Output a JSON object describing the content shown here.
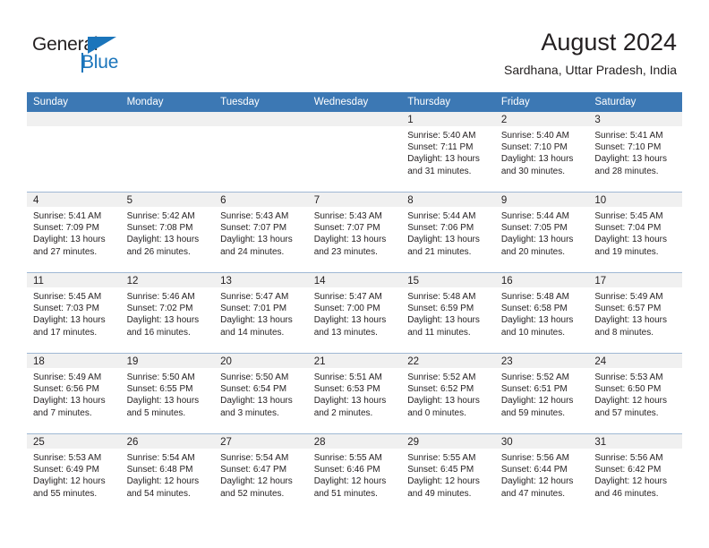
{
  "brand": {
    "name_part1": "General",
    "name_part2": "Blue",
    "triangle_color": "#1b75bb"
  },
  "header": {
    "title": "August 2024",
    "subtitle": "Sardhana, Uttar Pradesh, India"
  },
  "theme": {
    "header_band": "#3c78b4",
    "daynum_strip": "#f0f0f0",
    "grid_line": "#9fb8d4",
    "text": "#231f20"
  },
  "weekday_headers": [
    "Sunday",
    "Monday",
    "Tuesday",
    "Wednesday",
    "Thursday",
    "Friday",
    "Saturday"
  ],
  "weeks": [
    [
      {
        "day": "",
        "sunrise": "",
        "sunset": "",
        "daylight_line1": "",
        "daylight_line2": ""
      },
      {
        "day": "",
        "sunrise": "",
        "sunset": "",
        "daylight_line1": "",
        "daylight_line2": ""
      },
      {
        "day": "",
        "sunrise": "",
        "sunset": "",
        "daylight_line1": "",
        "daylight_line2": ""
      },
      {
        "day": "",
        "sunrise": "",
        "sunset": "",
        "daylight_line1": "",
        "daylight_line2": ""
      },
      {
        "day": "1",
        "sunrise": "Sunrise: 5:40 AM",
        "sunset": "Sunset: 7:11 PM",
        "daylight_line1": "Daylight: 13 hours",
        "daylight_line2": "and 31 minutes."
      },
      {
        "day": "2",
        "sunrise": "Sunrise: 5:40 AM",
        "sunset": "Sunset: 7:10 PM",
        "daylight_line1": "Daylight: 13 hours",
        "daylight_line2": "and 30 minutes."
      },
      {
        "day": "3",
        "sunrise": "Sunrise: 5:41 AM",
        "sunset": "Sunset: 7:10 PM",
        "daylight_line1": "Daylight: 13 hours",
        "daylight_line2": "and 28 minutes."
      }
    ],
    [
      {
        "day": "4",
        "sunrise": "Sunrise: 5:41 AM",
        "sunset": "Sunset: 7:09 PM",
        "daylight_line1": "Daylight: 13 hours",
        "daylight_line2": "and 27 minutes."
      },
      {
        "day": "5",
        "sunrise": "Sunrise: 5:42 AM",
        "sunset": "Sunset: 7:08 PM",
        "daylight_line1": "Daylight: 13 hours",
        "daylight_line2": "and 26 minutes."
      },
      {
        "day": "6",
        "sunrise": "Sunrise: 5:43 AM",
        "sunset": "Sunset: 7:07 PM",
        "daylight_line1": "Daylight: 13 hours",
        "daylight_line2": "and 24 minutes."
      },
      {
        "day": "7",
        "sunrise": "Sunrise: 5:43 AM",
        "sunset": "Sunset: 7:07 PM",
        "daylight_line1": "Daylight: 13 hours",
        "daylight_line2": "and 23 minutes."
      },
      {
        "day": "8",
        "sunrise": "Sunrise: 5:44 AM",
        "sunset": "Sunset: 7:06 PM",
        "daylight_line1": "Daylight: 13 hours",
        "daylight_line2": "and 21 minutes."
      },
      {
        "day": "9",
        "sunrise": "Sunrise: 5:44 AM",
        "sunset": "Sunset: 7:05 PM",
        "daylight_line1": "Daylight: 13 hours",
        "daylight_line2": "and 20 minutes."
      },
      {
        "day": "10",
        "sunrise": "Sunrise: 5:45 AM",
        "sunset": "Sunset: 7:04 PM",
        "daylight_line1": "Daylight: 13 hours",
        "daylight_line2": "and 19 minutes."
      }
    ],
    [
      {
        "day": "11",
        "sunrise": "Sunrise: 5:45 AM",
        "sunset": "Sunset: 7:03 PM",
        "daylight_line1": "Daylight: 13 hours",
        "daylight_line2": "and 17 minutes."
      },
      {
        "day": "12",
        "sunrise": "Sunrise: 5:46 AM",
        "sunset": "Sunset: 7:02 PM",
        "daylight_line1": "Daylight: 13 hours",
        "daylight_line2": "and 16 minutes."
      },
      {
        "day": "13",
        "sunrise": "Sunrise: 5:47 AM",
        "sunset": "Sunset: 7:01 PM",
        "daylight_line1": "Daylight: 13 hours",
        "daylight_line2": "and 14 minutes."
      },
      {
        "day": "14",
        "sunrise": "Sunrise: 5:47 AM",
        "sunset": "Sunset: 7:00 PM",
        "daylight_line1": "Daylight: 13 hours",
        "daylight_line2": "and 13 minutes."
      },
      {
        "day": "15",
        "sunrise": "Sunrise: 5:48 AM",
        "sunset": "Sunset: 6:59 PM",
        "daylight_line1": "Daylight: 13 hours",
        "daylight_line2": "and 11 minutes."
      },
      {
        "day": "16",
        "sunrise": "Sunrise: 5:48 AM",
        "sunset": "Sunset: 6:58 PM",
        "daylight_line1": "Daylight: 13 hours",
        "daylight_line2": "and 10 minutes."
      },
      {
        "day": "17",
        "sunrise": "Sunrise: 5:49 AM",
        "sunset": "Sunset: 6:57 PM",
        "daylight_line1": "Daylight: 13 hours",
        "daylight_line2": "and 8 minutes."
      }
    ],
    [
      {
        "day": "18",
        "sunrise": "Sunrise: 5:49 AM",
        "sunset": "Sunset: 6:56 PM",
        "daylight_line1": "Daylight: 13 hours",
        "daylight_line2": "and 7 minutes."
      },
      {
        "day": "19",
        "sunrise": "Sunrise: 5:50 AM",
        "sunset": "Sunset: 6:55 PM",
        "daylight_line1": "Daylight: 13 hours",
        "daylight_line2": "and 5 minutes."
      },
      {
        "day": "20",
        "sunrise": "Sunrise: 5:50 AM",
        "sunset": "Sunset: 6:54 PM",
        "daylight_line1": "Daylight: 13 hours",
        "daylight_line2": "and 3 minutes."
      },
      {
        "day": "21",
        "sunrise": "Sunrise: 5:51 AM",
        "sunset": "Sunset: 6:53 PM",
        "daylight_line1": "Daylight: 13 hours",
        "daylight_line2": "and 2 minutes."
      },
      {
        "day": "22",
        "sunrise": "Sunrise: 5:52 AM",
        "sunset": "Sunset: 6:52 PM",
        "daylight_line1": "Daylight: 13 hours",
        "daylight_line2": "and 0 minutes."
      },
      {
        "day": "23",
        "sunrise": "Sunrise: 5:52 AM",
        "sunset": "Sunset: 6:51 PM",
        "daylight_line1": "Daylight: 12 hours",
        "daylight_line2": "and 59 minutes."
      },
      {
        "day": "24",
        "sunrise": "Sunrise: 5:53 AM",
        "sunset": "Sunset: 6:50 PM",
        "daylight_line1": "Daylight: 12 hours",
        "daylight_line2": "and 57 minutes."
      }
    ],
    [
      {
        "day": "25",
        "sunrise": "Sunrise: 5:53 AM",
        "sunset": "Sunset: 6:49 PM",
        "daylight_line1": "Daylight: 12 hours",
        "daylight_line2": "and 55 minutes."
      },
      {
        "day": "26",
        "sunrise": "Sunrise: 5:54 AM",
        "sunset": "Sunset: 6:48 PM",
        "daylight_line1": "Daylight: 12 hours",
        "daylight_line2": "and 54 minutes."
      },
      {
        "day": "27",
        "sunrise": "Sunrise: 5:54 AM",
        "sunset": "Sunset: 6:47 PM",
        "daylight_line1": "Daylight: 12 hours",
        "daylight_line2": "and 52 minutes."
      },
      {
        "day": "28",
        "sunrise": "Sunrise: 5:55 AM",
        "sunset": "Sunset: 6:46 PM",
        "daylight_line1": "Daylight: 12 hours",
        "daylight_line2": "and 51 minutes."
      },
      {
        "day": "29",
        "sunrise": "Sunrise: 5:55 AM",
        "sunset": "Sunset: 6:45 PM",
        "daylight_line1": "Daylight: 12 hours",
        "daylight_line2": "and 49 minutes."
      },
      {
        "day": "30",
        "sunrise": "Sunrise: 5:56 AM",
        "sunset": "Sunset: 6:44 PM",
        "daylight_line1": "Daylight: 12 hours",
        "daylight_line2": "and 47 minutes."
      },
      {
        "day": "31",
        "sunrise": "Sunrise: 5:56 AM",
        "sunset": "Sunset: 6:42 PM",
        "daylight_line1": "Daylight: 12 hours",
        "daylight_line2": "and 46 minutes."
      }
    ]
  ]
}
